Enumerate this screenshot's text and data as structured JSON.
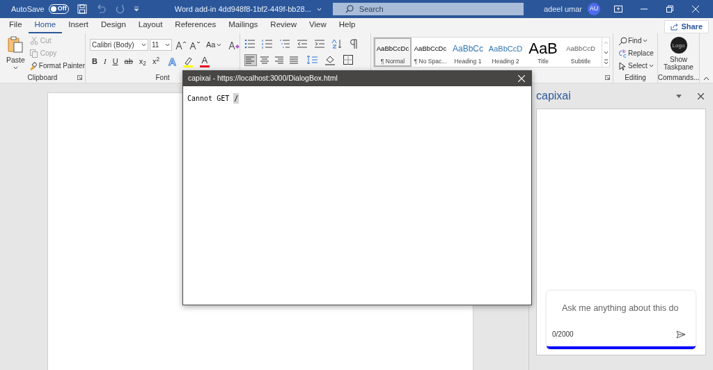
{
  "title_bar": {
    "autosave_label": "AutoSave",
    "autosave_toggle": {
      "label": "Off",
      "on": false
    },
    "document_title": "Word add-in 4dd948f8-1bf2-449f-bb28...",
    "search": {
      "placeholder": "Search"
    },
    "user_name": "adeel umar",
    "user_initials": "AU"
  },
  "tabs": [
    {
      "label": "File",
      "selected": false
    },
    {
      "label": "Home",
      "selected": true
    },
    {
      "label": "Insert",
      "selected": false
    },
    {
      "label": "Design",
      "selected": false
    },
    {
      "label": "Layout",
      "selected": false
    },
    {
      "label": "References",
      "selected": false
    },
    {
      "label": "Mailings",
      "selected": false
    },
    {
      "label": "Review",
      "selected": false
    },
    {
      "label": "View",
      "selected": false
    },
    {
      "label": "Help",
      "selected": false
    }
  ],
  "share_button": "Share",
  "clipboard": {
    "label": "Clipboard",
    "paste": "Paste",
    "cut": {
      "label": "Cut",
      "disabled": true
    },
    "copy": {
      "label": "Copy",
      "disabled": true
    },
    "format_painter": "Format Painter"
  },
  "font": {
    "label": "Font",
    "font_name": "Calibri (Body)",
    "font_size": "11",
    "change_case": "Aa",
    "format_buttons": [
      "B",
      "I",
      "U",
      "ab",
      "x$_{2}$",
      "x$^{2}$"
    ],
    "text_effects": "A",
    "font_color": "A"
  },
  "styles": [
    {
      "preview": "AaBbCcDc",
      "name": "¶ Normal",
      "kind": "normal",
      "selected": true
    },
    {
      "preview": "AaBbCcDc",
      "name": "¶ No Spac...",
      "kind": "normal",
      "selected": false
    },
    {
      "preview": "AaBbCc",
      "name": "Heading 1",
      "kind": "heading1",
      "selected": false
    },
    {
      "preview": "AaBbCcD",
      "name": "Heading 2",
      "kind": "heading2",
      "selected": false
    },
    {
      "preview": "AaB",
      "name": "Title",
      "kind": "title",
      "selected": false
    },
    {
      "preview": "AaBbCcD",
      "name": "Subtitle",
      "kind": "subtitle",
      "selected": false
    }
  ],
  "editing": {
    "label": "Editing",
    "find": "Find",
    "replace": "Replace",
    "select": "Select"
  },
  "commands": {
    "label": "Commands...",
    "logo": "Logo",
    "button": "Show Taskpane"
  },
  "dialog": {
    "title": "capixai - https://localhost:3000/DialogBox.html",
    "message": "Cannot GET",
    "path": "/"
  },
  "task_pane": {
    "title": "capixai",
    "chat_input": {
      "placeholder": "Ask me anything about this do"
    },
    "counter": "0/2000"
  }
}
